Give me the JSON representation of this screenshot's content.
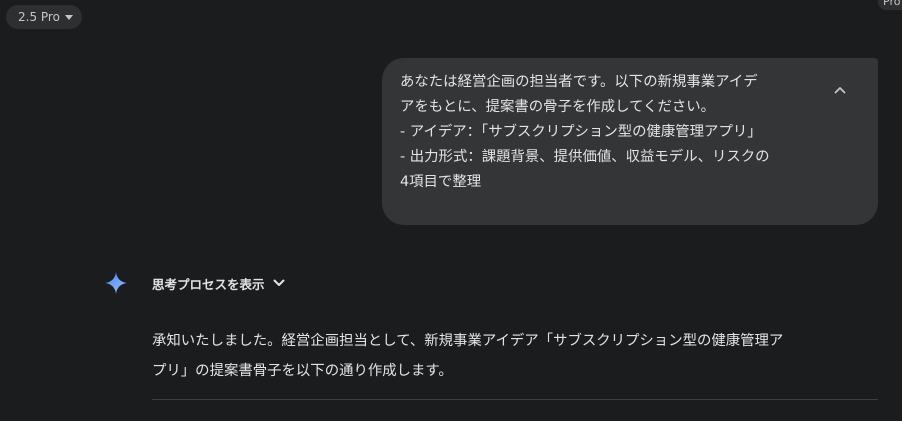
{
  "header": {
    "model_label": "2.5 Pro",
    "corner_label": "Pro"
  },
  "user_message": {
    "lines": [
      "あなたは経営企画の担当者です。以下の新規事業アイデ",
      "アをもとに、提案書の骨子を作成してください。",
      "- アイデア：「サブスクリプション型の健康管理アプリ」",
      "- 出力形式：課題背景、提供価値、収益モデル、リスクの",
      "4項目で整理"
    ]
  },
  "assistant": {
    "thinking_toggle_label": "思考プロセスを表示",
    "response_lines": [
      "承知いたしました。経営企画担当として、新規事業アイデア「サブスクリプション型の健康管理ア",
      "プリ」の提案書骨子を以下の通り作成します。"
    ]
  },
  "colors": {
    "background": "#1b1c1d",
    "bubble": "#333537",
    "chip": "#2d2f31",
    "text": "#e3e3e3",
    "sparkle_top": "#4285f4",
    "sparkle_bottom": "#9fc2ff"
  },
  "icons": {
    "model_menu": "caret-down-icon",
    "collapse": "chevron-up-icon",
    "assistant_avatar": "gemini-sparkle-icon",
    "thinking_expand": "chevron-down-icon"
  }
}
